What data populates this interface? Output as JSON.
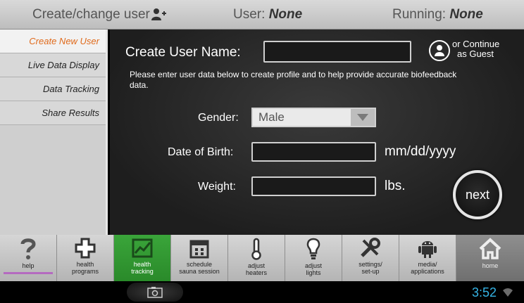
{
  "header": {
    "title": "Create/change user",
    "user_label": "User:",
    "user_value": "None",
    "running_label": "Running:",
    "running_value": "None"
  },
  "sidebar": {
    "items": [
      {
        "label": "Create New User",
        "active": true
      },
      {
        "label": "Live Data Display"
      },
      {
        "label": "Data Tracking"
      },
      {
        "label": "Share Results"
      }
    ]
  },
  "form": {
    "username_label": "Create User Name:",
    "username_value": "",
    "guest_label_1": "or Continue",
    "guest_label_2": "as Guest",
    "instructions": "Please enter user data below to create profile and to help provide accurate biofeedback data.",
    "gender_label": "Gender:",
    "gender_value": "Male",
    "dob_label": "Date of Birth:",
    "dob_value": "",
    "dob_hint": "mm/dd/yyyy",
    "weight_label": "Weight:",
    "weight_value": "",
    "weight_unit": "lbs.",
    "next_label": "next"
  },
  "toolbar": {
    "items": [
      {
        "line1": "help",
        "line2": "",
        "icon": "question-icon"
      },
      {
        "line1": "health",
        "line2": "programs",
        "icon": "cross-icon"
      },
      {
        "line1": "health",
        "line2": "tracking",
        "icon": "chart-icon",
        "active": true
      },
      {
        "line1": "schedule",
        "line2": "sauna session",
        "icon": "calendar-icon"
      },
      {
        "line1": "adjust",
        "line2": "heaters",
        "icon": "thermometer-icon"
      },
      {
        "line1": "adjust",
        "line2": "lights",
        "icon": "lightbulb-icon"
      },
      {
        "line1": "settings/",
        "line2": "set-up",
        "icon": "wrench-icon"
      },
      {
        "line1": "media/",
        "line2": "applications",
        "icon": "android-icon"
      },
      {
        "line1": "home",
        "line2": "",
        "icon": "home-icon"
      }
    ]
  },
  "status": {
    "time": "3:52"
  },
  "colors": {
    "accent_active": "#e06a1b",
    "tracking_green": "#2a8a2a",
    "clock_blue": "#35b4e6"
  }
}
